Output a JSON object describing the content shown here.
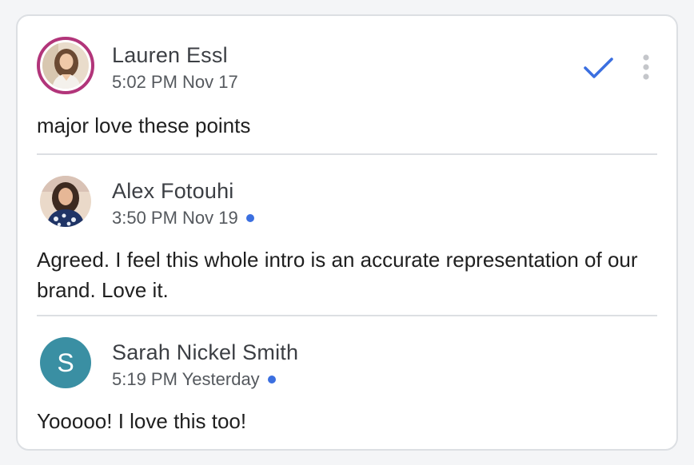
{
  "comments": [
    {
      "author": "Lauren Essl",
      "timestamp": "5:02 PM Nov 17",
      "text": "major love these points",
      "unread": false
    },
    {
      "author": "Alex Fotouhi",
      "timestamp": "3:50 PM Nov 19",
      "text": "Agreed. I feel this whole intro is an accurate representation of our brand. Love it.",
      "unread": true
    },
    {
      "author": "Sarah Nickel Smith",
      "avatar_letter": "S",
      "timestamp": "5:19 PM Yesterday",
      "text": "Yooooo! I love this too!",
      "unread": true
    }
  ],
  "actions": {
    "resolve_icon": "checkmark-icon",
    "more_icon": "more-vert-icon"
  },
  "colors": {
    "accent": "#3b6fe0",
    "avatar_ring": "#b2357a",
    "letter_avatar_bg": "#3a8fa3",
    "divider": "#dcdfe3"
  }
}
